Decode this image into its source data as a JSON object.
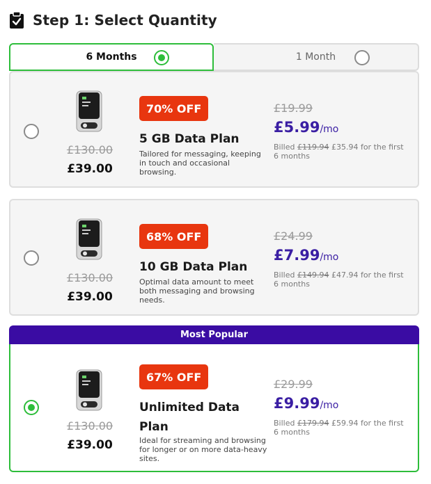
{
  "header": {
    "title": "Step 1: Select Quantity",
    "icon": "clipboard-check-icon"
  },
  "tabs": [
    {
      "label": "6 Months",
      "selected": true
    },
    {
      "label": "1 Month",
      "selected": false
    }
  ],
  "popular_banner": "Most Popular",
  "colors": {
    "accent_green": "#2dbd3a",
    "brand_purple": "#3a0ca3",
    "discount_red": "#e8360f",
    "price_purple": "#3a1ea3"
  },
  "plans": [
    {
      "selected": false,
      "device_old_price": "£130.00",
      "device_new_price": "£39.00",
      "discount": "70% OFF",
      "name": "5 GB Data Plan",
      "description": "Tailored for messaging, keeping in touch and occasional browsing.",
      "monthly_was": "£19.99",
      "monthly_now": "£5.99",
      "per": "/mo",
      "billed_prefix": "Billed ",
      "billed_was": "£119.94",
      "billed_now": " £35.94 for the first 6 months"
    },
    {
      "selected": false,
      "device_old_price": "£130.00",
      "device_new_price": "£39.00",
      "discount": "68% OFF",
      "name": "10 GB Data Plan",
      "description": "Optimal data amount to meet both messaging and browsing needs.",
      "monthly_was": "£24.99",
      "monthly_now": "£7.99",
      "per": "/mo",
      "billed_prefix": "Billed ",
      "billed_was": "£149.94",
      "billed_now": " £47.94 for the first 6 months"
    },
    {
      "selected": true,
      "device_old_price": "£130.00",
      "device_new_price": "£39.00",
      "discount": "67% OFF",
      "name": "Unlimited Data Plan",
      "description": "Ideal for streaming and browsing for longer or on more data-heavy sites.",
      "monthly_was": "£29.99",
      "monthly_now": "£9.99",
      "per": "/mo",
      "billed_prefix": "Billed ",
      "billed_was": "£179.94",
      "billed_now": " £59.94 for the first 6 months"
    }
  ]
}
